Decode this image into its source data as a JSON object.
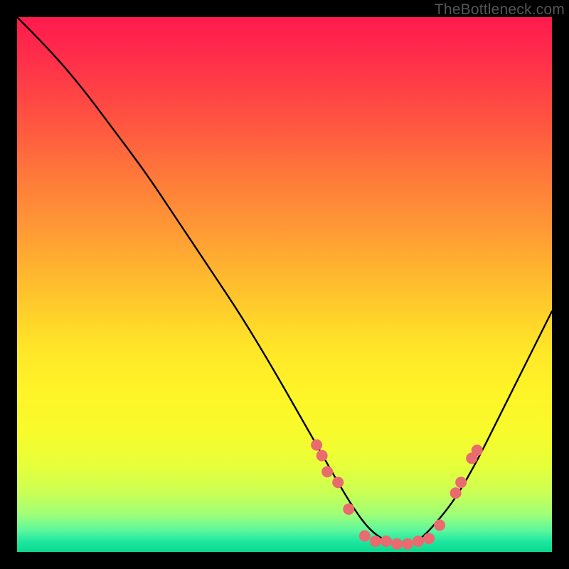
{
  "brand": "TheBottleneck.com",
  "chart_data": {
    "type": "line",
    "title": "",
    "xlabel": "",
    "ylabel": "",
    "xlim": [
      0,
      100
    ],
    "ylim": [
      0,
      100
    ],
    "grid": false,
    "legend": false,
    "curve": {
      "name": "bottleneck-curve",
      "color": "#000000",
      "x": [
        0,
        6,
        12,
        18,
        24,
        30,
        36,
        42,
        48,
        52,
        56,
        60,
        63,
        66,
        69,
        72,
        75,
        78,
        82,
        86,
        90,
        94,
        98,
        100
      ],
      "y": [
        100,
        94,
        87,
        79,
        71,
        62,
        53,
        44,
        34,
        27,
        20,
        13,
        8,
        4,
        2,
        1,
        2,
        5,
        10,
        17,
        25,
        33,
        41,
        45
      ]
    },
    "markers": {
      "name": "threshold-dots",
      "color": "#e96a6f",
      "radius": 8,
      "points": [
        [
          56,
          20
        ],
        [
          57,
          18
        ],
        [
          58,
          15
        ],
        [
          60,
          13
        ],
        [
          62,
          8
        ],
        [
          65,
          3
        ],
        [
          67,
          2
        ],
        [
          69,
          2
        ],
        [
          71,
          1.5
        ],
        [
          73,
          1.5
        ],
        [
          75,
          2
        ],
        [
          77,
          2.5
        ],
        [
          79,
          5
        ],
        [
          82,
          11
        ],
        [
          83,
          13
        ],
        [
          85,
          17.5
        ],
        [
          86,
          19
        ]
      ]
    }
  }
}
